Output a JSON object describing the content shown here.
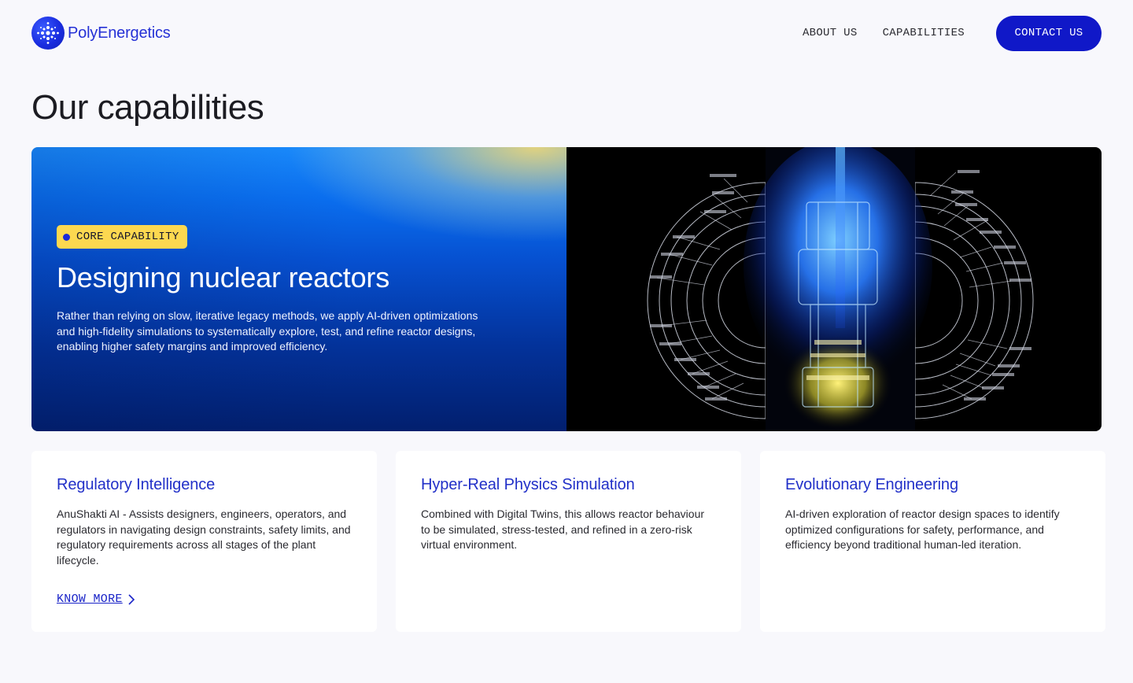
{
  "header": {
    "brand_name": "PolyEnergetics",
    "logo_icon": "logo-dots-icon",
    "nav": [
      {
        "label": "ABOUT US"
      },
      {
        "label": "CAPABILITIES"
      }
    ],
    "contact_label": "CONTACT US"
  },
  "page": {
    "title": "Our capabilities"
  },
  "hero": {
    "badge": "CORE CAPABILITY",
    "title": "Designing nuclear reactors",
    "description": "Rather than relying on slow, iterative legacy methods, we apply AI-driven optimizations and high-fidelity simulations to systematically explore, test, and refine reactor designs, enabling higher safety margins and improved efficiency.",
    "image_icon": "reactor-blueprint-illustration"
  },
  "cards": [
    {
      "title": "Regulatory Intelligence",
      "description": "AnuShakti AI - Assists designers, engineers, operators, and regulators in navigating design constraints, safety limits, and regulatory requirements across all stages of the plant lifecycle.",
      "link": "KNOW MORE",
      "link_icon": "chevron-right-icon"
    },
    {
      "title": "Hyper-Real Physics Simulation",
      "description": "Combined with Digital Twins, this allows reactor behaviour to be simulated, stress-tested, and refined in a zero-risk virtual environment."
    },
    {
      "title": "Evolutionary Engineering",
      "description": "AI-driven exploration of reactor design spaces to identify optimized configurations for safety, performance, and efficiency beyond traditional human-led iteration."
    }
  ],
  "colors": {
    "accent": "#1018c8",
    "badge": "#fcd850",
    "card_title": "#2230c8",
    "background": "#f8f8fc"
  }
}
